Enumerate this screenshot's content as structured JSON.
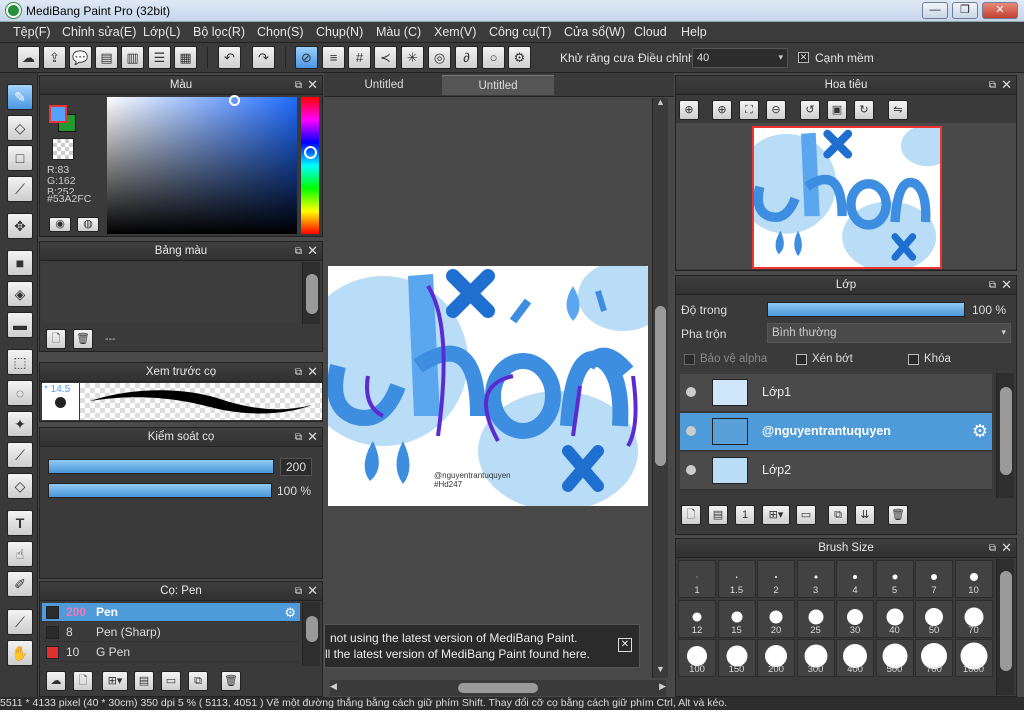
{
  "window": {
    "title": "MediBang Paint Pro (32bit)",
    "minimize": "—",
    "restore": "❐",
    "close": "✕"
  },
  "menu": [
    "Tệp(F)",
    "Chỉnh sửa(E)",
    "Lớp(L)",
    "Bộ lọc(R)",
    "Chọn(S)",
    "Chụp(N)",
    "Màu (C)",
    "Xem(V)",
    "Công cụ(T)",
    "Cửa sổ(W)",
    "Cloud",
    "Help"
  ],
  "toolbar": {
    "antialias_label": "Khử răng cưa",
    "correction_label": "Điều chỉnh",
    "correction_value": "40",
    "smooth_label": "Cạnh mềm",
    "antialias_checked": "☒",
    "smooth_checked": "✕"
  },
  "color_panel": {
    "title": "Màu",
    "r": "R:83",
    "g": "G:162",
    "b": "B:252",
    "hex": "#53A2FC",
    "primary": "#53a2fc",
    "secondary": "#1e9a2e"
  },
  "palette_panel": {
    "title": "Bảng màu",
    "name": "---"
  },
  "preview_panel": {
    "title": "Xem trước cọ",
    "size": "* 14.5"
  },
  "control_panel": {
    "title": "Kiểm soát cọ",
    "size_value": "200",
    "opacity_value": "100 %",
    "size_fraction": 0.91,
    "opacity_fraction": 1.0
  },
  "brush_panel": {
    "title": "Cọ: Pen",
    "items": [
      {
        "size": "200",
        "name": "Pen",
        "color": "#2b2b2b",
        "selected": true
      },
      {
        "size": "8",
        "name": "Pen (Sharp)",
        "color": "#2b2b2b",
        "selected": false
      },
      {
        "size": "10",
        "name": "G Pen",
        "color": "#e03030",
        "selected": false
      }
    ]
  },
  "doc_tabs": [
    "Untitled",
    "Untitled"
  ],
  "artwork": {
    "watermark": "@nguyentrantuquyen",
    "tag": "#Hd247"
  },
  "notice": {
    "line1": "not using the latest version of MediBang Paint.",
    "line2": "ll the latest version of MediBang Paint found here.",
    "close": "✕"
  },
  "navigator_panel": {
    "title": "Hoa tiêu"
  },
  "layer_panel": {
    "title": "Lớp",
    "opacity_label": "Độ trong",
    "opacity_value": "100 %",
    "opacity_fraction": 1.0,
    "blend_label": "Pha trộn",
    "blend_value": "Bình thường",
    "protect_alpha": "Bảo vệ alpha",
    "clip": "Xén bớt",
    "lock": "Khóa",
    "layers": [
      {
        "name": "Lớp1",
        "selected": false
      },
      {
        "name": "@nguyentrantuquyen",
        "selected": true
      },
      {
        "name": "Lớp2",
        "selected": false
      }
    ]
  },
  "brush_size_panel": {
    "title": "Brush Size",
    "sizes": [
      "1",
      "1.5",
      "2",
      "3",
      "4",
      "5",
      "7",
      "10",
      "12",
      "15",
      "20",
      "25",
      "30",
      "40",
      "50",
      "70",
      "100",
      "150",
      "200",
      "300",
      "400",
      "500",
      "700",
      "1000"
    ]
  },
  "status": "5511 * 4133 pixel   (40 * 30cm)   350 dpi   5 %   ( 5113, 4051 )   Vẽ một đường thẳng bằng cách giữ phím Shift. Thay đổi cỡ cọ bằng cách giữ phím Ctrl, Alt và kéo."
}
